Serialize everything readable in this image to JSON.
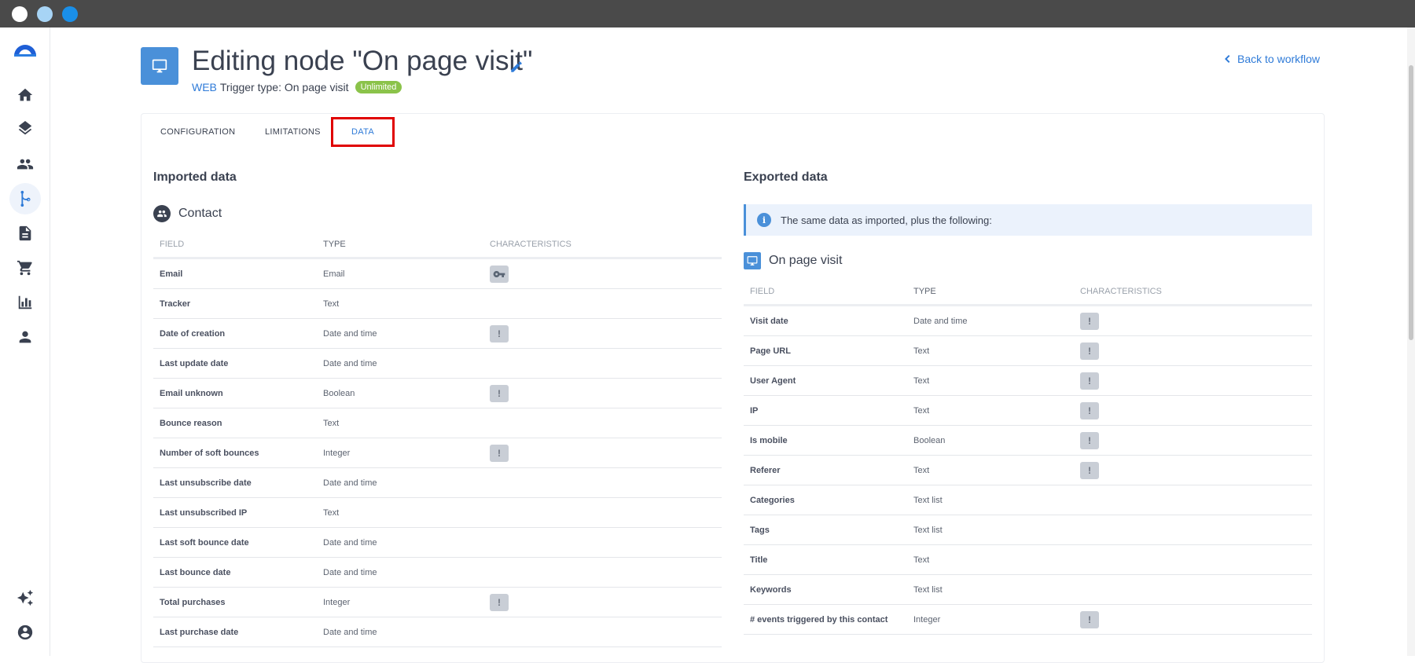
{
  "window": {
    "dot_colors": [
      "#ffffff",
      "#a7d4f5",
      "#1a8fe8"
    ]
  },
  "sidebar": {
    "logo": "logo-icon",
    "items": [
      {
        "name": "home-icon",
        "active": false
      },
      {
        "name": "layers-icon",
        "active": false
      },
      {
        "name": "contacts-icon",
        "active": false
      },
      {
        "name": "workflow-icon",
        "active": true
      },
      {
        "name": "document-icon",
        "active": false
      },
      {
        "name": "cart-icon",
        "active": false
      },
      {
        "name": "chart-icon",
        "active": false
      },
      {
        "name": "person-icon",
        "active": false
      }
    ],
    "bottom": [
      "sparkle-icon",
      "account-icon"
    ]
  },
  "header": {
    "title": "Editing node \"On page visit\"",
    "channel": "WEB",
    "trigger_type": "Trigger type: On page visit",
    "badge": "Unlimited",
    "back_link": "Back to workflow"
  },
  "tabs": [
    {
      "label": "CONFIGURATION"
    },
    {
      "label": "LIMITATIONS"
    },
    {
      "label": "DATA",
      "active": true
    }
  ],
  "imported": {
    "title": "Imported data",
    "entity": "Contact",
    "columns": [
      "FIELD",
      "TYPE",
      "CHARACTERISTICS"
    ],
    "rows": [
      {
        "field": "Email",
        "type": "Email",
        "char": "key"
      },
      {
        "field": "Tracker",
        "type": "Text",
        "char": ""
      },
      {
        "field": "Date of creation",
        "type": "Date and time",
        "char": "!"
      },
      {
        "field": "Last update date",
        "type": "Date and time",
        "char": ""
      },
      {
        "field": "Email unknown",
        "type": "Boolean",
        "char": "!"
      },
      {
        "field": "Bounce reason",
        "type": "Text",
        "char": ""
      },
      {
        "field": "Number of soft bounces",
        "type": "Integer",
        "char": "!"
      },
      {
        "field": "Last unsubscribe date",
        "type": "Date and time",
        "char": ""
      },
      {
        "field": "Last unsubscribed IP",
        "type": "Text",
        "char": ""
      },
      {
        "field": "Last soft bounce date",
        "type": "Date and time",
        "char": ""
      },
      {
        "field": "Last bounce date",
        "type": "Date and time",
        "char": ""
      },
      {
        "field": "Total purchases",
        "type": "Integer",
        "char": "!"
      },
      {
        "field": "Last purchase date",
        "type": "Date and time",
        "char": ""
      }
    ]
  },
  "exported": {
    "title": "Exported data",
    "info": "The same data as imported, plus the following:",
    "entity": "On page visit",
    "columns": [
      "FIELD",
      "TYPE",
      "CHARACTERISTICS"
    ],
    "rows": [
      {
        "field": "Visit date",
        "type": "Date and time",
        "char": "!"
      },
      {
        "field": "Page URL",
        "type": "Text",
        "char": "!"
      },
      {
        "field": "User Agent",
        "type": "Text",
        "char": "!"
      },
      {
        "field": "IP",
        "type": "Text",
        "char": "!"
      },
      {
        "field": "Is mobile",
        "type": "Boolean",
        "char": "!"
      },
      {
        "field": "Referer",
        "type": "Text",
        "char": "!"
      },
      {
        "field": "Categories",
        "type": "Text list",
        "char": ""
      },
      {
        "field": "Tags",
        "type": "Text list",
        "char": ""
      },
      {
        "field": "Title",
        "type": "Text",
        "char": ""
      },
      {
        "field": "Keywords",
        "type": "Text list",
        "char": ""
      },
      {
        "field": "# events triggered by this contact",
        "type": "Integer",
        "char": "!"
      }
    ]
  }
}
